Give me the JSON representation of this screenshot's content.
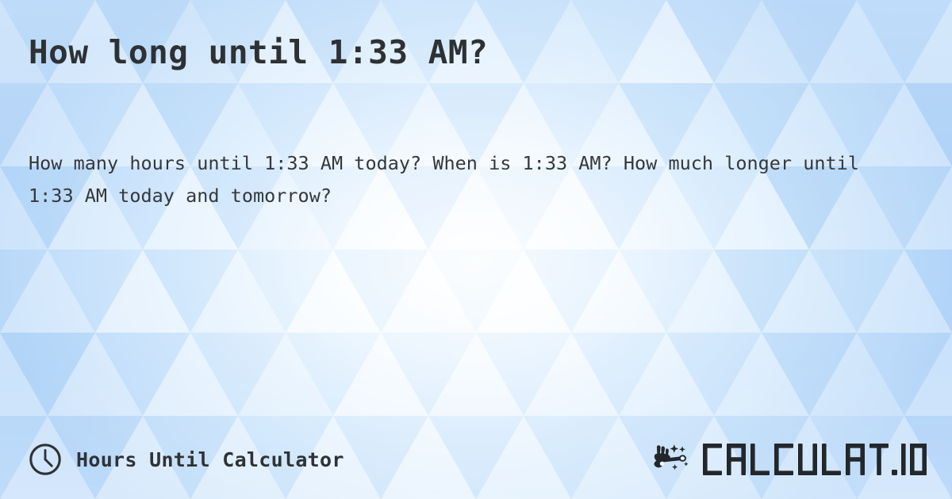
{
  "page": {
    "headline": "How long until 1:33 AM?",
    "subtext": "How many hours until 1:33 AM today? When is 1:33 AM? How much longer until 1:33 AM today and tomorrow?",
    "target_time": "1:33 AM"
  },
  "footer": {
    "brand_label": "Hours Until Calculator",
    "clock_icon": "clock-icon",
    "logo": {
      "wordmark": "CALCULAT.IO",
      "mark_icon": "magic-wand-hand-icon"
    }
  },
  "colors": {
    "text_dark": "#2e3134",
    "text_body": "#34383c",
    "bg_blue_light": "#eaf5ff",
    "bg_blue_mid": "#bcdcfa",
    "bg_blue_deep": "#a9d0f6",
    "logo_dark": "#23272b"
  }
}
